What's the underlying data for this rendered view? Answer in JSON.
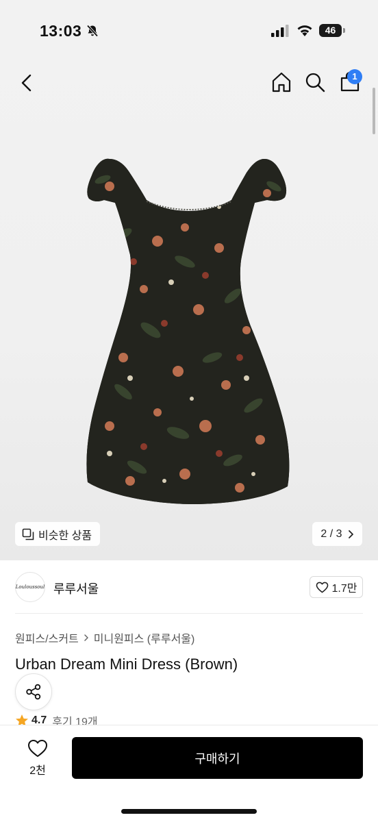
{
  "status_bar": {
    "time": "13:03",
    "battery": "46",
    "icons": [
      "bell-slash-icon",
      "cellular-signal-icon",
      "wifi-icon",
      "battery-icon"
    ]
  },
  "nav": {
    "icons": [
      "chevron-left-icon",
      "home-icon",
      "search-icon",
      "shopping-bag-icon"
    ],
    "cart_badge": "1",
    "accent_color": "#2f7ef5"
  },
  "gallery": {
    "similar_label": "비슷한 상품",
    "page_indicator": "2 / 3"
  },
  "seller": {
    "logo_text": "Louloussoul",
    "name": "루루서울",
    "like_count": "1.7만"
  },
  "breadcrumb": {
    "category": "원피스/스커트",
    "subcategory": "미니원피스 (루루서울)"
  },
  "product": {
    "title": "Urban Dream Mini Dress (Brown)"
  },
  "rating": {
    "value": "4.7",
    "reviews": "후기 19개",
    "star_color": "#f5a623"
  },
  "bottom_bar": {
    "wish_count": "2천",
    "buy_label": "구매하기",
    "buy_color": "#000000"
  }
}
